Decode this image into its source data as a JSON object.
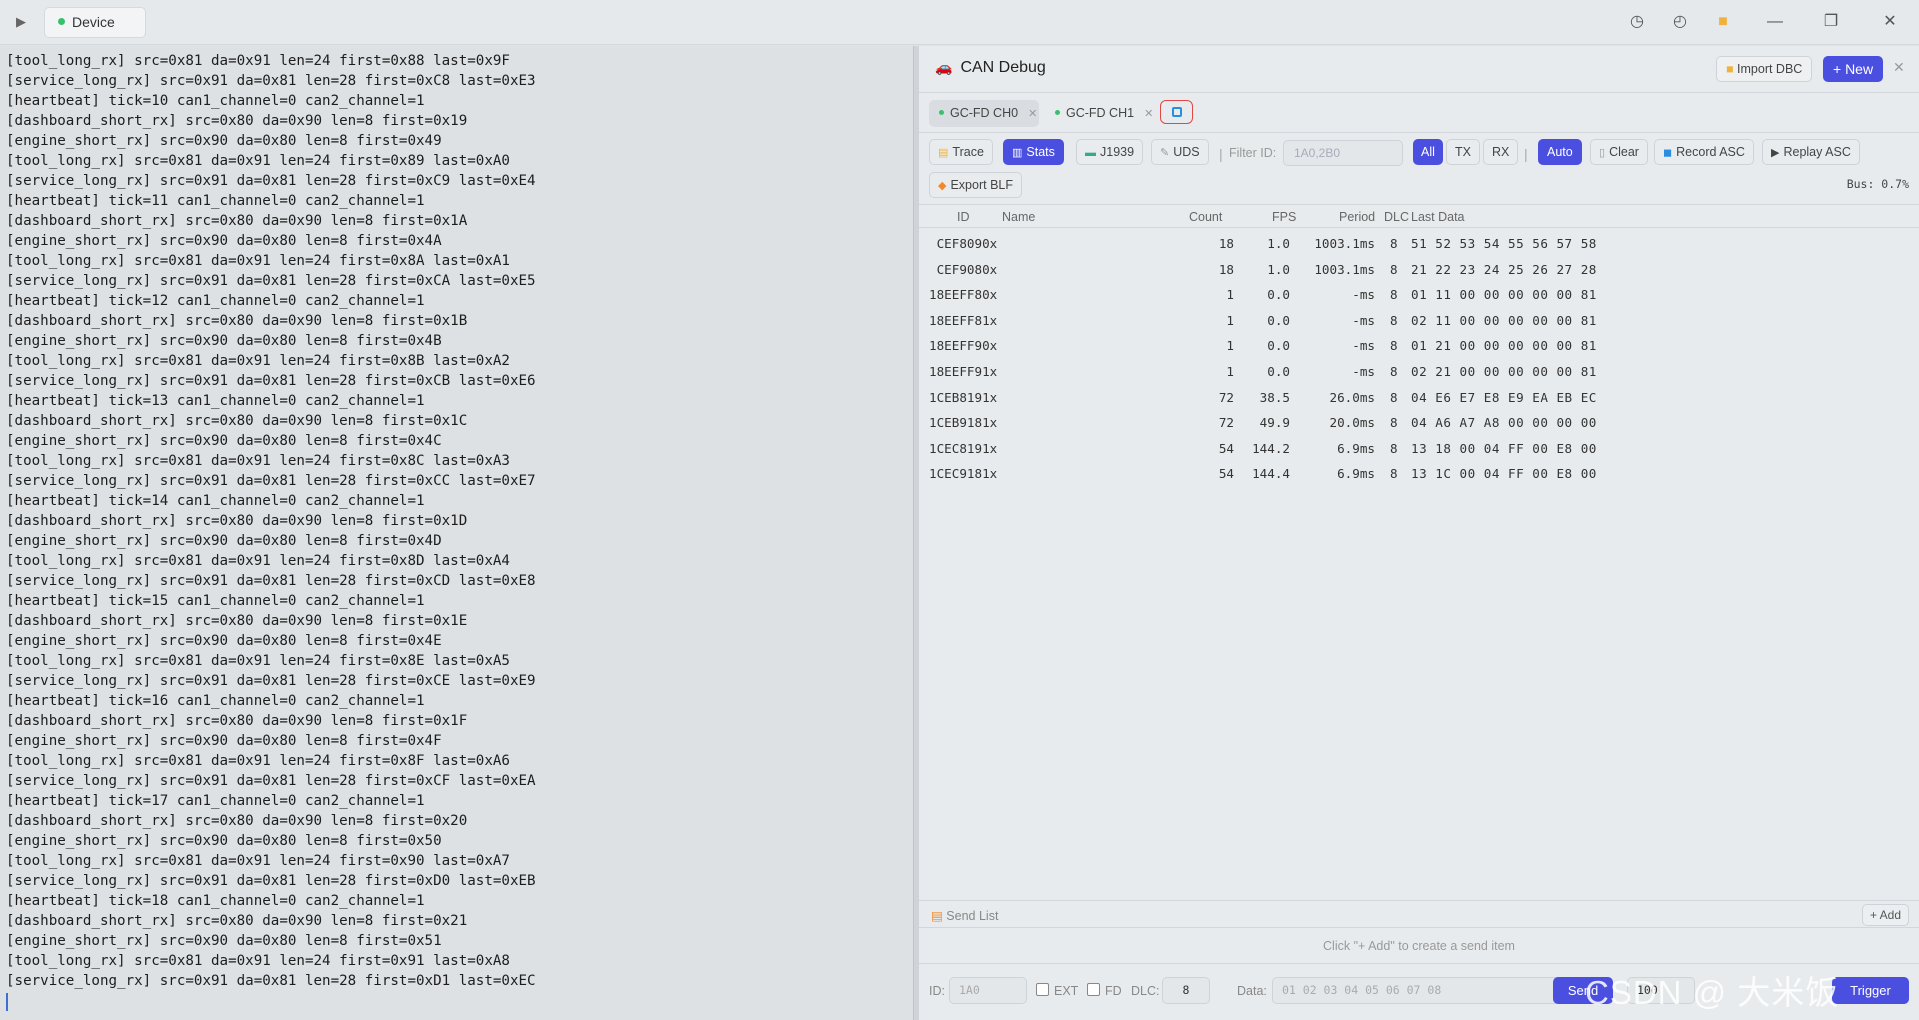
{
  "titlebar": {
    "device_tab": "Device",
    "icons": [
      "play-icon",
      "history-clock-icon",
      "clock-icon",
      "folder-icon",
      "minimize-icon",
      "restore-icon",
      "close-icon"
    ]
  },
  "terminal": {
    "lines": [
      "[tool_long_rx] src=0x81 da=0x91 len=24 first=0x88 last=0x9F",
      "[service_long_rx] src=0x91 da=0x81 len=28 first=0xC8 last=0xE3",
      "[heartbeat] tick=10 can1_channel=0 can2_channel=1",
      "[dashboard_short_rx] src=0x80 da=0x90 len=8 first=0x19",
      "[engine_short_rx] src=0x90 da=0x80 len=8 first=0x49",
      "[tool_long_rx] src=0x81 da=0x91 len=24 first=0x89 last=0xA0",
      "[service_long_rx] src=0x91 da=0x81 len=28 first=0xC9 last=0xE4",
      "[heartbeat] tick=11 can1_channel=0 can2_channel=1",
      "[dashboard_short_rx] src=0x80 da=0x90 len=8 first=0x1A",
      "[engine_short_rx] src=0x90 da=0x80 len=8 first=0x4A",
      "[tool_long_rx] src=0x81 da=0x91 len=24 first=0x8A last=0xA1",
      "[service_long_rx] src=0x91 da=0x81 len=28 first=0xCA last=0xE5",
      "[heartbeat] tick=12 can1_channel=0 can2_channel=1",
      "[dashboard_short_rx] src=0x80 da=0x90 len=8 first=0x1B",
      "[engine_short_rx] src=0x90 da=0x80 len=8 first=0x4B",
      "[tool_long_rx] src=0x81 da=0x91 len=24 first=0x8B last=0xA2",
      "[service_long_rx] src=0x91 da=0x81 len=28 first=0xCB last=0xE6",
      "[heartbeat] tick=13 can1_channel=0 can2_channel=1",
      "[dashboard_short_rx] src=0x80 da=0x90 len=8 first=0x1C",
      "[engine_short_rx] src=0x90 da=0x80 len=8 first=0x4C",
      "[tool_long_rx] src=0x81 da=0x91 len=24 first=0x8C last=0xA3",
      "[service_long_rx] src=0x91 da=0x81 len=28 first=0xCC last=0xE7",
      "[heartbeat] tick=14 can1_channel=0 can2_channel=1",
      "[dashboard_short_rx] src=0x80 da=0x90 len=8 first=0x1D",
      "[engine_short_rx] src=0x90 da=0x80 len=8 first=0x4D",
      "[tool_long_rx] src=0x81 da=0x91 len=24 first=0x8D last=0xA4",
      "[service_long_rx] src=0x91 da=0x81 len=28 first=0xCD last=0xE8",
      "[heartbeat] tick=15 can1_channel=0 can2_channel=1",
      "[dashboard_short_rx] src=0x80 da=0x90 len=8 first=0x1E",
      "[engine_short_rx] src=0x90 da=0x80 len=8 first=0x4E",
      "[tool_long_rx] src=0x81 da=0x91 len=24 first=0x8E last=0xA5",
      "[service_long_rx] src=0x91 da=0x81 len=28 first=0xCE last=0xE9",
      "[heartbeat] tick=16 can1_channel=0 can2_channel=1",
      "[dashboard_short_rx] src=0x80 da=0x90 len=8 first=0x1F",
      "[engine_short_rx] src=0x90 da=0x80 len=8 first=0x4F",
      "[tool_long_rx] src=0x81 da=0x91 len=24 first=0x8F last=0xA6",
      "[service_long_rx] src=0x91 da=0x81 len=28 first=0xCF last=0xEA",
      "[heartbeat] tick=17 can1_channel=0 can2_channel=1",
      "[dashboard_short_rx] src=0x80 da=0x90 len=8 first=0x20",
      "[engine_short_rx] src=0x90 da=0x80 len=8 first=0x50",
      "[tool_long_rx] src=0x81 da=0x91 len=24 first=0x90 last=0xA7",
      "[service_long_rx] src=0x91 da=0x81 len=28 first=0xD0 last=0xEB",
      "[heartbeat] tick=18 can1_channel=0 can2_channel=1",
      "[dashboard_short_rx] src=0x80 da=0x90 len=8 first=0x21",
      "[engine_short_rx] src=0x90 da=0x80 len=8 first=0x51",
      "[tool_long_rx] src=0x81 da=0x91 len=24 first=0x91 last=0xA8",
      "[service_long_rx] src=0x91 da=0x81 len=28 first=0xD1 last=0xEC"
    ]
  },
  "panel": {
    "title": "CAN Debug",
    "import_dbc": "Import DBC",
    "new_label": "+ New",
    "channels": [
      {
        "label": "GC-FD CH0",
        "active": true
      },
      {
        "label": "GC-FD CH1",
        "active": false
      }
    ],
    "toolbar": {
      "trace": "Trace",
      "stats": "Stats",
      "j1939": "J1939",
      "uds": "UDS",
      "filter_label": "Filter ID:",
      "filter_placeholder": "1A0,2B0",
      "all": "All",
      "tx": "TX",
      "rx": "RX",
      "auto": "Auto",
      "clear": "Clear",
      "record_asc": "Record ASC",
      "replay_asc": "Replay ASC",
      "export_blf": "Export BLF",
      "bus": "Bus: 0.7%"
    },
    "stats_headers": {
      "id": "ID",
      "name": "Name",
      "count": "Count",
      "fps": "FPS",
      "period": "Period",
      "dlc": "DLC",
      "data": "Last Data"
    },
    "stats_rows": [
      {
        "id": " CEF8090x",
        "count": "18",
        "fps": "1.0",
        "period": "1003.1ms",
        "dlc": "8",
        "data": "51 52 53 54 55 56 57 58"
      },
      {
        "id": " CEF9080x",
        "count": "18",
        "fps": "1.0",
        "period": "1003.1ms",
        "dlc": "8",
        "data": "21 22 23 24 25 26 27 28"
      },
      {
        "id": "18EEFF80x",
        "count": "1",
        "fps": "0.0",
        "period": "-ms",
        "dlc": "8",
        "data": "01 11 00 00 00 00 00 81"
      },
      {
        "id": "18EEFF81x",
        "count": "1",
        "fps": "0.0",
        "period": "-ms",
        "dlc": "8",
        "data": "02 11 00 00 00 00 00 81"
      },
      {
        "id": "18EEFF90x",
        "count": "1",
        "fps": "0.0",
        "period": "-ms",
        "dlc": "8",
        "data": "01 21 00 00 00 00 00 81"
      },
      {
        "id": "18EEFF91x",
        "count": "1",
        "fps": "0.0",
        "period": "-ms",
        "dlc": "8",
        "data": "02 21 00 00 00 00 00 81"
      },
      {
        "id": "1CEB8191x",
        "count": "72",
        "fps": "38.5",
        "period": "26.0ms",
        "dlc": "8",
        "data": "04 E6 E7 E8 E9 EA EB EC"
      },
      {
        "id": "1CEB9181x",
        "count": "72",
        "fps": "49.9",
        "period": "20.0ms",
        "dlc": "8",
        "data": "04 A6 A7 A8 00 00 00 00"
      },
      {
        "id": "1CEC8191x",
        "count": "54",
        "fps": "144.2",
        "period": "6.9ms",
        "dlc": "8",
        "data": "13 18 00 04 FF 00 E8 00"
      },
      {
        "id": "1CEC9181x",
        "count": "54",
        "fps": "144.4",
        "period": "6.9ms",
        "dlc": "8",
        "data": "13 1C 00 04 FF 00 E8 00"
      }
    ],
    "send_list": {
      "title": "Send List",
      "add": "+ Add",
      "empty_hint": "Click \"+ Add\" to create a send item"
    },
    "send_bar": {
      "id_label": "ID:",
      "id_placeholder": "1A0",
      "ext": "EXT",
      "fd": "FD",
      "dlc_label": "DLC:",
      "dlc_value": "8",
      "data_label": "Data:",
      "data_placeholder": "01 02 03 04 05 06 07 08",
      "send": "Send",
      "period_value": "100",
      "trigger": "Trigger"
    }
  },
  "watermark": "CSDN @ 大米饭"
}
